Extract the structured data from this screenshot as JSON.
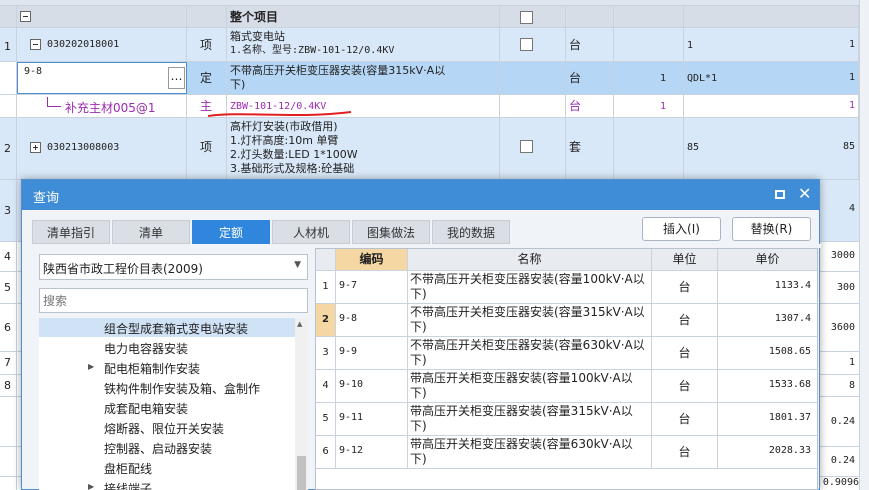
{
  "grid": {
    "header": {
      "title": "整个项目"
    },
    "rows": [
      {
        "index": "1",
        "code": "030202018001",
        "kind": "项",
        "name_lines": [
          "箱式变电站",
          "1.名称、型号:ZBW-101-12/0.4KV"
        ],
        "unit": "台",
        "qty_expr": "1",
        "total": "1"
      },
      {
        "index": "",
        "code": "9-8",
        "kind": "定",
        "name_lines": [
          "不带高压开关柜变压器安装(容量315kV·A以",
          "下)"
        ],
        "unit": "台",
        "content": "1",
        "qty_expr": "QDL*1",
        "total": "1"
      },
      {
        "index": "",
        "code": "补充主材005@1",
        "kind": "主",
        "name_lines": [
          "ZBW-101-12/0.4KV"
        ],
        "unit": "台",
        "content": "1",
        "qty_expr": "",
        "total": "1"
      },
      {
        "index": "2",
        "code": "030213008003",
        "kind": "项",
        "name_lines": [
          "高杆灯安装(市政借用)",
          "1.灯杆高度:10m 单臂",
          "2.灯头数量:LED 1*100W",
          "3.基础形式及规格:砼基础"
        ],
        "unit": "套",
        "qty_expr": "85",
        "total": "85"
      },
      {
        "index": "3",
        "total": "4"
      },
      {
        "index": "4",
        "total": "3000"
      },
      {
        "index": "5",
        "total": "300"
      },
      {
        "index": "6",
        "total": "3600"
      },
      {
        "index": "7",
        "total": "1"
      },
      {
        "index": "8",
        "total": "8"
      },
      {
        "index": "",
        "total": "0.24"
      },
      {
        "index": "",
        "total": "0.24"
      },
      {
        "index": "",
        "total": "0.9096"
      }
    ]
  },
  "dialog": {
    "title": "查询",
    "tabs": [
      "清单指引",
      "清单",
      "定额",
      "人材机",
      "图集做法",
      "我的数据"
    ],
    "active_tab": "定额",
    "insert_label": "插入(I)",
    "replace_label": "替换(R)",
    "library_select": "陕西省市政工程价目表(2009)",
    "search_placeholder": "搜索",
    "tree": [
      {
        "label": "组合型成套箱式变电站安装",
        "selected": true
      },
      {
        "label": "电力电容器安装"
      },
      {
        "label": "配电柜箱制作安装",
        "expandable": true
      },
      {
        "label": "铁构件制作安装及箱、盒制作"
      },
      {
        "label": "成套配电箱安装"
      },
      {
        "label": "熔断器、限位开关安装"
      },
      {
        "label": "控制器、启动器安装"
      },
      {
        "label": "盘柜配线"
      },
      {
        "label": "接线端子",
        "expandable": true
      }
    ],
    "table": {
      "headers": [
        "编码",
        "名称",
        "单位",
        "单价"
      ],
      "rows": [
        {
          "no": "1",
          "code": "9-7",
          "name": "不带高压开关柜变压器安装(容量100kV·A以下)",
          "unit": "台",
          "price": "1133.4"
        },
        {
          "no": "2",
          "code": "9-8",
          "name": "不带高压开关柜变压器安装(容量315kV·A以下)",
          "unit": "台",
          "price": "1307.4"
        },
        {
          "no": "3",
          "code": "9-9",
          "name": "不带高压开关柜变压器安装(容量630kV·A以下)",
          "unit": "台",
          "price": "1508.65"
        },
        {
          "no": "4",
          "code": "9-10",
          "name": "带高压开关柜变压器安装(容量100kV·A以下)",
          "unit": "台",
          "price": "1533.68"
        },
        {
          "no": "5",
          "code": "9-11",
          "name": "带高压开关柜变压器安装(容量315kV·A以下)",
          "unit": "台",
          "price": "1801.37"
        },
        {
          "no": "6",
          "code": "9-12",
          "name": "带高压开关柜变压器安装(容量630kV·A以下)",
          "unit": "台",
          "price": "2028.33"
        }
      ]
    }
  },
  "colors": {
    "accent": "#2f86dc",
    "title_bar": "#3f8dd6",
    "row_selected": "#cfe2f6",
    "purple": "#9b2bb0",
    "annotation_red": "#e02020"
  }
}
